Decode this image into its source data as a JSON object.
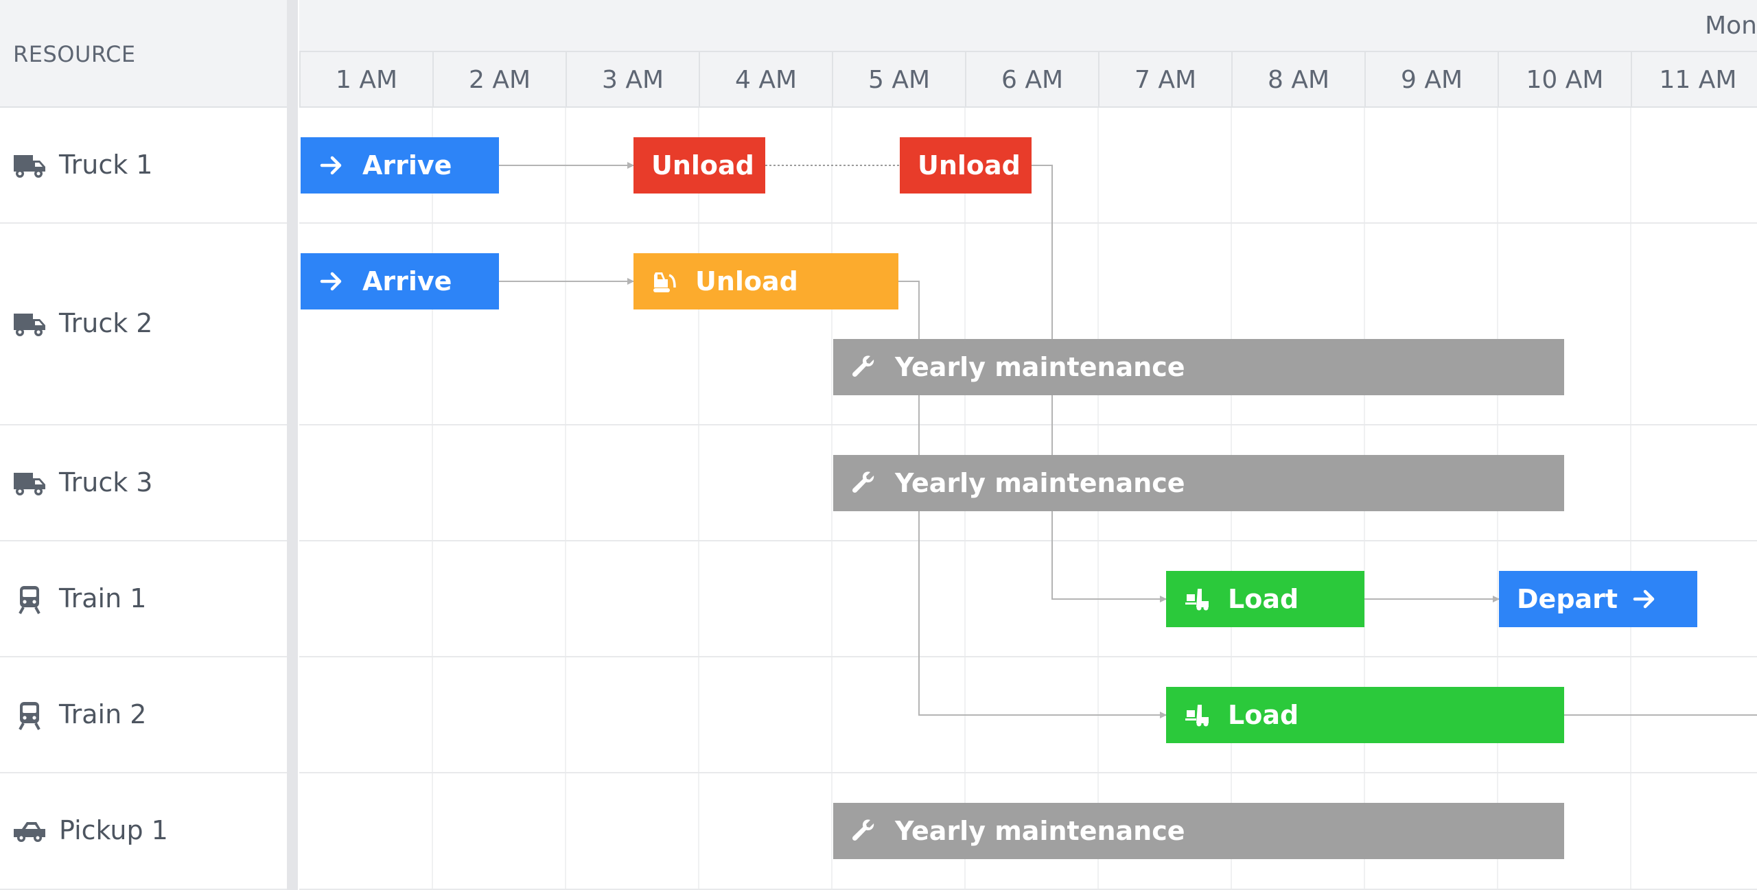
{
  "resource_header": "RESOURCE",
  "day_label": "Mon",
  "hours": [
    "1 AM",
    "2 AM",
    "3 AM",
    "4 AM",
    "5 AM",
    "6 AM",
    "7 AM",
    "8 AM",
    "9 AM",
    "10 AM",
    "11 AM"
  ],
  "resources": [
    {
      "name": "Truck 1",
      "icon": "truck-icon"
    },
    {
      "name": "Truck 2",
      "icon": "truck-icon"
    },
    {
      "name": "Truck 3",
      "icon": "truck-icon"
    },
    {
      "name": "Train 1",
      "icon": "train-icon"
    },
    {
      "name": "Train 2",
      "icon": "train-icon"
    },
    {
      "name": "Pickup 1",
      "icon": "pickup-icon"
    }
  ],
  "events": [
    {
      "id": "e1",
      "label": "Arrive",
      "resource": 0,
      "lane": 0,
      "start": 0.0,
      "end": 1.5,
      "color": "#2d84f7",
      "icon": "arrow-right-icon"
    },
    {
      "id": "e2",
      "label": "Unload",
      "resource": 0,
      "lane": 0,
      "start": 2.5,
      "end": 3.5,
      "color": "#e83c2a",
      "icon": ""
    },
    {
      "id": "e3",
      "label": "Unload",
      "resource": 0,
      "lane": 0,
      "start": 4.5,
      "end": 5.5,
      "color": "#e83c2a",
      "icon": ""
    },
    {
      "id": "e4",
      "label": "Arrive",
      "resource": 1,
      "lane": 0,
      "start": 0.0,
      "end": 1.5,
      "color": "#2d84f7",
      "icon": "arrow-right-icon"
    },
    {
      "id": "e5",
      "label": "Unload",
      "resource": 1,
      "lane": 0,
      "start": 2.5,
      "end": 4.5,
      "color": "#fcab2d",
      "icon": "bulldozer-icon"
    },
    {
      "id": "e6",
      "label": "Yearly maintenance",
      "resource": 1,
      "lane": 1,
      "start": 4.0,
      "end": 9.5,
      "color": "#a0a0a0",
      "icon": "wrench-icon"
    },
    {
      "id": "e7",
      "label": "Yearly maintenance",
      "resource": 2,
      "lane": 0,
      "start": 4.0,
      "end": 9.5,
      "color": "#a0a0a0",
      "icon": "wrench-icon"
    },
    {
      "id": "e8",
      "label": "Load",
      "resource": 3,
      "lane": 0,
      "start": 6.5,
      "end": 8.0,
      "color": "#2bc93b",
      "icon": "forklift-icon"
    },
    {
      "id": "e9",
      "label": "Depart",
      "resource": 3,
      "lane": 0,
      "start": 9.0,
      "end": 10.5,
      "color": "#2d84f7",
      "icon": "arrow-right-icon",
      "icon_after": true
    },
    {
      "id": "e10",
      "label": "Load",
      "resource": 4,
      "lane": 0,
      "start": 6.5,
      "end": 9.5,
      "color": "#2bc93b",
      "icon": "forklift-icon"
    },
    {
      "id": "e11",
      "label": "Yearly maintenance",
      "resource": 5,
      "lane": 0,
      "start": 4.0,
      "end": 9.5,
      "color": "#a0a0a0",
      "icon": "wrench-icon"
    }
  ],
  "dependencies": [
    {
      "from": "e1",
      "to": "e2",
      "style": "solid"
    },
    {
      "from": "e2",
      "to": "e3",
      "style": "dotted"
    },
    {
      "from": "e4",
      "to": "e5",
      "style": "solid"
    },
    {
      "from": "e3",
      "to": "e8",
      "style": "solid"
    },
    {
      "from": "e5",
      "to": "e10",
      "style": "solid"
    },
    {
      "from": "e8",
      "to": "e9",
      "style": "solid"
    },
    {
      "from": "e10",
      "to": "offscreen",
      "style": "solid"
    }
  ]
}
